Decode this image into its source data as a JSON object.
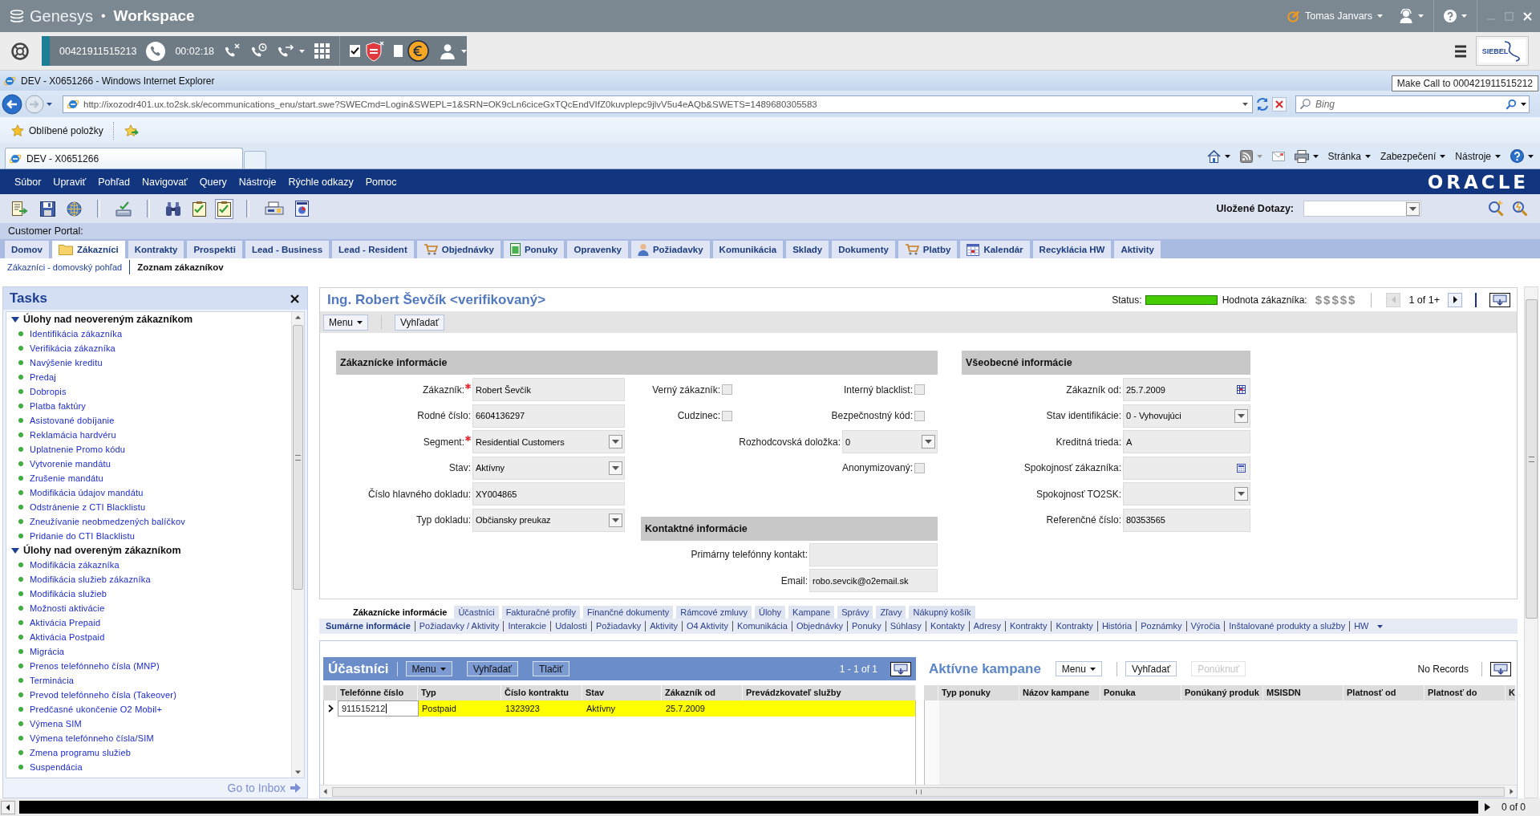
{
  "genesys": {
    "brand": "Genesys",
    "separator": "•",
    "product": "Workspace",
    "user": "Tomas Janvars",
    "phone_number": "00421911515213",
    "call_timer": "00:02:18",
    "toggles": [
      {
        "kind": "shield",
        "checked": true
      },
      {
        "kind": "euro",
        "checked": false
      }
    ],
    "logo": "SIEBEL"
  },
  "browser": {
    "title": "DEV - X0651266 - Windows Internet Explorer",
    "tooltip": "Make Call to 000421911515212",
    "url": "http://ixozodr401.ux.to2sk.sk/ecommunications_enu/start.swe?SWECmd=Login&SWEPL=1&SRN=OK9cLn6ciceGxTQcEndVIfZ0kuvplepc9jlvV5u4eAQb&SWETS=1489680305583",
    "search": {
      "placeholder": "Bing"
    },
    "favorites": "Oblíbené položky",
    "tab": "DEV - X0651266",
    "commands": [
      "Stránka",
      "Zabezpečení",
      "Nástroje"
    ]
  },
  "siebel": {
    "menu": [
      "Súbor",
      "Upraviť",
      "Pohľad",
      "Navigovať",
      "Query",
      "Nástroje",
      "Rýchle odkazy",
      "Pomoc"
    ],
    "logo": "ORACLE",
    "toolbar": [
      {
        "kind": "export",
        "pressed": false
      },
      {
        "kind": "save",
        "pressed": false
      },
      {
        "kind": "globe",
        "pressed": false
      },
      {
        "kind": "separator"
      },
      {
        "kind": "inbox",
        "pressed": false
      },
      {
        "kind": "separator"
      },
      {
        "kind": "binoculars",
        "pressed": false
      },
      {
        "kind": "checklist",
        "pressed": false
      },
      {
        "kind": "checklist",
        "pressed": true
      },
      {
        "kind": "separator"
      },
      {
        "kind": "fax",
        "pressed": false
      },
      {
        "kind": "report",
        "pressed": false
      }
    ],
    "saved_queries": {
      "label": "Uložené Dotazy:"
    },
    "portal": "Customer Portal:",
    "screen_tabs": [
      {
        "label": "Domov",
        "selected": false,
        "kind": "plain"
      },
      {
        "label": "Zákazníci",
        "selected": true,
        "kind": "folder"
      },
      {
        "label": "Kontrakty",
        "selected": false,
        "kind": "plain"
      },
      {
        "label": "Prospekti",
        "selected": false,
        "kind": "plain"
      },
      {
        "label": "Lead - Business",
        "selected": false,
        "kind": "plain"
      },
      {
        "label": "Lead - Resident",
        "selected": false,
        "kind": "plain"
      },
      {
        "label": "Objednávky",
        "selected": false,
        "kind": "cart"
      },
      {
        "label": "Ponuky",
        "selected": false,
        "kind": "document"
      },
      {
        "label": "Opravenky",
        "selected": false,
        "kind": "plain"
      },
      {
        "label": "Požiadavky",
        "selected": false,
        "kind": "person"
      },
      {
        "label": "Komunikácia",
        "selected": false,
        "kind": "plain"
      },
      {
        "label": "Sklady",
        "selected": false,
        "kind": "plain"
      },
      {
        "label": "Dokumenty",
        "selected": false,
        "kind": "plain"
      },
      {
        "label": "Platby",
        "selected": false,
        "kind": "cart"
      },
      {
        "label": "Kalendár",
        "selected": false,
        "kind": "calendar"
      },
      {
        "label": "Recyklácia HW",
        "selected": false,
        "kind": "plain"
      },
      {
        "label": "Aktivity",
        "selected": false,
        "kind": "plain"
      }
    ],
    "views": [
      {
        "label": "Zákazníci - domovský pohľad",
        "selected": false
      },
      {
        "label": "Zoznam zákazníkov",
        "selected": true
      }
    ]
  },
  "tasks": {
    "title": "Tasks",
    "groups": [
      {
        "label": "Úlohy nad neovereným zákazníkom",
        "expanded": true,
        "children": [
          "Identifikácia zákazníka",
          "Verifikácia zákazníka",
          "Navýšenie kreditu",
          "Predaj",
          "Dobropis",
          "Platba faktúry",
          "Asistované dobíjanie",
          "Reklamácia hardvéru",
          "Uplatnenie Promo kódu",
          "Vytvorenie mandátu",
          "Zrušenie mandátu",
          "Modifikácia údajov mandátu",
          "Odstránenie z CTI Blacklistu",
          "Zneužívanie neobmedzených balíčkov",
          "Pridanie do CTI Blacklistu"
        ]
      },
      {
        "label": "Úlohy nad overeným zákazníkom",
        "expanded": true,
        "children": [
          "Modifikácia zákazníka",
          "Modifikácia služieb zákazníka",
          "Modifikácia služieb",
          "Možnosti aktivácie",
          "Aktivácia Prepaid",
          "Aktivácia Postpaid",
          "Migrácia",
          "Prenos telefónneho čísla (MNP)",
          "Terminácia",
          "Prevod telefónneho čísla (Takeover)",
          "Predčasné ukončenie O2 Mobil+",
          "Výmena SIM",
          "Výmena telefónneho čísla/SIM",
          "Zmena programu služieb",
          "Suspendácia"
        ]
      }
    ],
    "footer": "Go to Inbox"
  },
  "record": {
    "title": "Ing. Robert Ševčík <verifikovaný>",
    "status": {
      "label": "Status:",
      "color": "#44cc00"
    },
    "value": {
      "label": "Hodnota zákazníka:",
      "rating": "$$$$$",
      "disabled": true
    },
    "pager": {
      "text": "1 of 1+",
      "prev_disabled": true,
      "next_disabled": false
    },
    "buttons": [
      {
        "label": "Menu",
        "kind": "menu"
      },
      {
        "label": "Vyhľadať",
        "kind": "plain"
      }
    ],
    "customer_info": {
      "title": "Zákaznícke informácie",
      "columns": [
        [
          {
            "label": "Zákazník:",
            "required": true,
            "kind": "text",
            "value": "Robert Ševčík"
          },
          {
            "label": "Rodné číslo:",
            "required": false,
            "kind": "text",
            "value": "6604136297"
          },
          {
            "label": "Segment:",
            "required": true,
            "kind": "select",
            "value": "Residential Customers"
          },
          {
            "label": "Stav:",
            "required": false,
            "kind": "select",
            "value": "Aktívny"
          },
          {
            "label": "Číslo hlavného dokladu:",
            "required": false,
            "kind": "text",
            "value": "XY004865"
          },
          {
            "label": "Typ dokladu:",
            "required": false,
            "kind": "select",
            "value": "Občiansky preukaz"
          }
        ],
        [
          {
            "label": "Verný zákazník:",
            "required": false,
            "kind": "checkbox",
            "checked": false
          },
          {
            "label": "Cudzinec:",
            "required": false,
            "kind": "checkbox",
            "checked": false
          }
        ],
        [
          {
            "label": "Interný blacklist:",
            "required": false,
            "kind": "checkbox",
            "checked": false
          },
          {
            "label": "Bezpečnostný kód:",
            "required": false,
            "kind": "checkbox",
            "checked": false
          },
          {
            "label": "Rozhodcovská doložka:",
            "required": false,
            "kind": "select",
            "value": "0"
          },
          {
            "label": "Anonymizovaný:",
            "required": false,
            "kind": "checkbox",
            "checked": false
          }
        ]
      ],
      "contact": {
        "title": "Kontaktné informácie",
        "fields": [
          {
            "label": "Primárny telefónny kontakt:",
            "kind": "text"
          },
          {
            "label": "Email:",
            "kind": "text",
            "value": "robo.sevcik@o2email.sk"
          }
        ]
      }
    },
    "general_info": {
      "title": "Všeobecné informácie",
      "fields": [
        {
          "label": "Zákazník od:",
          "kind": "date",
          "value": "25.7.2009"
        },
        {
          "label": "Stav identifikácie:",
          "kind": "select",
          "value": "0 - Vyhovujúci"
        },
        {
          "label": "Kreditná trieda:",
          "kind": "text",
          "value": "A"
        },
        {
          "label": "Spokojnosť zákazníka:",
          "kind": "calc"
        },
        {
          "label": "Spokojnosť TO2SK:",
          "kind": "select"
        },
        {
          "label": "Referenčné číslo:",
          "kind": "text",
          "value": "80353565"
        }
      ]
    }
  },
  "view_tabs": [
    {
      "label": "Zákaznícke informácie",
      "selected": true
    },
    {
      "label": "Účastníci",
      "selected": false
    },
    {
      "label": "Fakturačné profily",
      "selected": false
    },
    {
      "label": "Finančné dokumenty",
      "selected": false
    },
    {
      "label": "Rámcové zmluvy",
      "selected": false
    },
    {
      "label": "Úlohy",
      "selected": false
    },
    {
      "label": "Kampane",
      "selected": false
    },
    {
      "label": "Správy",
      "selected": false
    },
    {
      "label": "Zľavy",
      "selected": false
    },
    {
      "label": "Nákupný košík",
      "selected": false
    }
  ],
  "subviews": [
    {
      "label": "Sumárne informácie",
      "selected": true
    },
    {
      "label": "Požiadavky / Aktivity",
      "selected": false
    },
    {
      "label": "Interakcie",
      "selected": false
    },
    {
      "label": "Udalosti",
      "selected": false
    },
    {
      "label": "Požiadavky",
      "selected": false
    },
    {
      "label": "Aktivity",
      "selected": false
    },
    {
      "label": "O4 Aktivity",
      "selected": false
    },
    {
      "label": "Komunikácia",
      "selected": false
    },
    {
      "label": "Objednávky",
      "selected": false
    },
    {
      "label": "Ponuky",
      "selected": false
    },
    {
      "label": "Súhlasy",
      "selected": false
    },
    {
      "label": "Kontakty",
      "selected": false
    },
    {
      "label": "Adresy",
      "selected": false
    },
    {
      "label": "Kontrakty",
      "selected": false
    },
    {
      "label": "Kontrakty",
      "selected": false
    },
    {
      "label": "História",
      "selected": false
    },
    {
      "label": "Poznámky",
      "selected": false
    },
    {
      "label": "Výročia",
      "selected": false
    },
    {
      "label": "Inštalované produkty a služby",
      "selected": false
    },
    {
      "label": "HW",
      "selected": false
    }
  ],
  "subscribers": {
    "title": "Účastníci",
    "buttons": [
      {
        "label": "Menu",
        "kind": "menu",
        "disabled": false
      },
      {
        "label": "Vyhľadať",
        "kind": "plain",
        "disabled": false
      },
      {
        "label": "Tlačiť",
        "kind": "plain",
        "disabled": false
      }
    ],
    "count": "1 - 1 of 1",
    "columns": [
      "Telefónne číslo",
      "Typ",
      "Číslo kontraktu",
      "Stav",
      "Zákazník od",
      "Prevádzkovateľ služby"
    ],
    "rows": [
      {
        "selected": true,
        "cells": [
          "911515212",
          "Postpaid",
          "1323923",
          "Aktívny",
          "25.7.2009"
        ]
      }
    ]
  },
  "campaigns": {
    "title": "Aktívne kampane",
    "buttons": [
      {
        "label": "Menu",
        "kind": "menu",
        "disabled": false
      },
      {
        "label": "Vyhľadať",
        "kind": "plain",
        "disabled": false
      },
      {
        "label": "Ponúknuť",
        "kind": "plain",
        "disabled": true
      }
    ],
    "count": "No Records",
    "columns": [
      "Typ ponuky",
      "Názov kampane",
      "Ponuka",
      "Ponúkaný produk",
      "MSISDN",
      "Platnosť od",
      "Platnosť do",
      "K"
    ]
  },
  "status_bar": {
    "text": "0 of 0"
  }
}
